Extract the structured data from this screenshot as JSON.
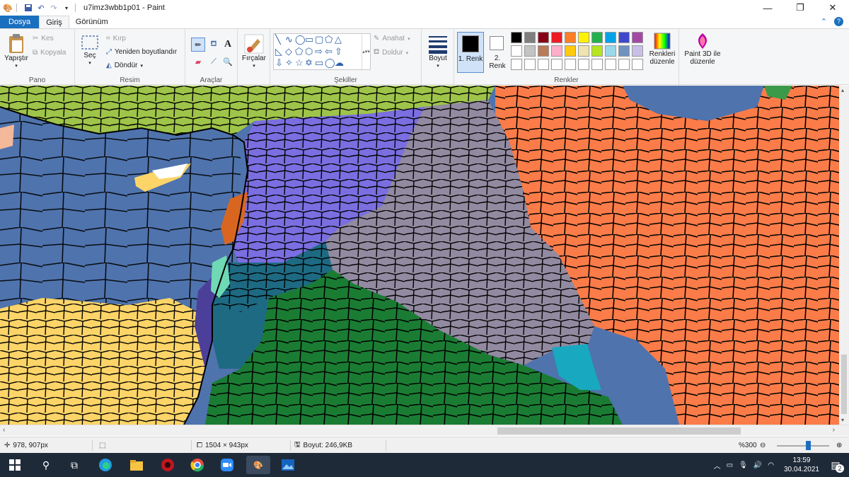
{
  "window": {
    "title": "u7imz3wbb1p01 - Paint",
    "controls": [
      "minimize",
      "maximize",
      "close"
    ]
  },
  "ribbon_tabs": [
    {
      "label": "Dosya"
    },
    {
      "label": "Giriş"
    },
    {
      "label": "Görünüm"
    }
  ],
  "ribbon": {
    "pano": {
      "label": "Pano",
      "paste": "Yapıştır",
      "cut": "Kes",
      "copy": "Kopyala"
    },
    "resim": {
      "label": "Resim",
      "select": "Seç",
      "crop": "Kırp",
      "resize": "Yeniden boyutlandır",
      "rotate": "Döndür"
    },
    "araclar": {
      "label": "Araçlar"
    },
    "fircalar": {
      "label": "Fırçalar"
    },
    "sekiller": {
      "label": "Şekiller",
      "outline": "Anahat",
      "fill": "Doldur"
    },
    "boyut": {
      "label": "Boyut"
    },
    "renkler": {
      "label": "Renkler",
      "color1": "1. Renk",
      "color2": "2. Renk",
      "edit_colors": "Renkleri düzenle",
      "paint3d": "Paint 3D ile düzenle",
      "palette_row1": [
        "#000000",
        "#7f7f7f",
        "#880015",
        "#ed1c24",
        "#ff7f27",
        "#fff200",
        "#22b14c",
        "#00a2e8",
        "#3f48cc",
        "#a349a4"
      ],
      "palette_row2": [
        "#ffffff",
        "#c3c3c3",
        "#b97a57",
        "#ffaec9",
        "#ffc90e",
        "#efe4b0",
        "#b5e61d",
        "#99d9ea",
        "#7092be",
        "#c8bfe7"
      ]
    }
  },
  "statusbar": {
    "cursor_pos": "978, 907px",
    "selection": "",
    "image_size": "1504 × 943px",
    "file_size": "Boyut: 246,9KB",
    "zoom": "%300"
  },
  "taskbar": {
    "time": "13:59",
    "date": "30.04.2021",
    "notifications": "2"
  },
  "map_colors": {
    "sea": "#4f73ad",
    "green_light": "#9ec449",
    "purple": "#7b6ee0",
    "grey": "#928aa0",
    "orange": "#fb7c48",
    "dark_green": "#1a7c33",
    "teal": "#1d6a82",
    "yellow": "#fcd468",
    "orange_dark": "#d86621",
    "cyan": "#18a8c0",
    "indigo": "#4b3f9a",
    "mint": "#6fd8b4"
  }
}
